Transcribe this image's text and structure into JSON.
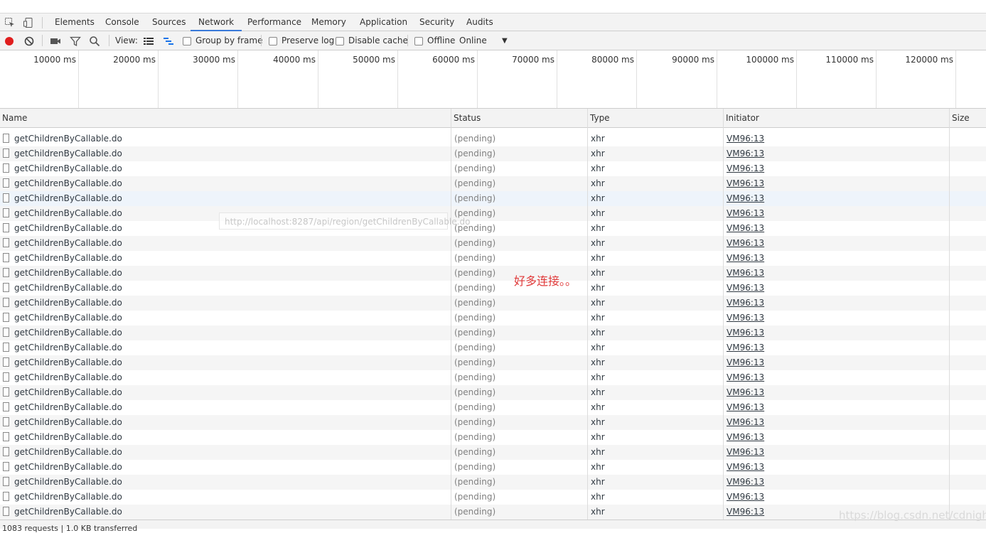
{
  "tabs": [
    "Elements",
    "Console",
    "Sources",
    "Network",
    "Performance",
    "Memory",
    "Application",
    "Security",
    "Audits"
  ],
  "active_tab": "Network",
  "toolbar": {
    "view_label": "View:",
    "group_by_frame": "Group by frame",
    "preserve_log": "Preserve log",
    "disable_cache": "Disable cache",
    "offline": "Offline",
    "throttle": "Online"
  },
  "timeline_ticks": [
    "10000 ms",
    "20000 ms",
    "30000 ms",
    "40000 ms",
    "50000 ms",
    "60000 ms",
    "70000 ms",
    "80000 ms",
    "90000 ms",
    "100000 ms",
    "110000 ms",
    "120000 ms"
  ],
  "columns": {
    "name": "Name",
    "status": "Status",
    "type": "Type",
    "initiator": "Initiator",
    "size": "Size"
  },
  "request": {
    "name": "getChildrenByCallable.do",
    "status": "(pending)",
    "type": "xhr",
    "initiator": "VM96:13"
  },
  "visible_row_count": 26,
  "tooltip": "http://localhost:8287/api/region/getChildrenByCallable.do",
  "annotation": "好多连接。。",
  "footer": "1083 requests | 1.0 KB transferred",
  "watermark": "https://blog.csdn.net/cdnight"
}
